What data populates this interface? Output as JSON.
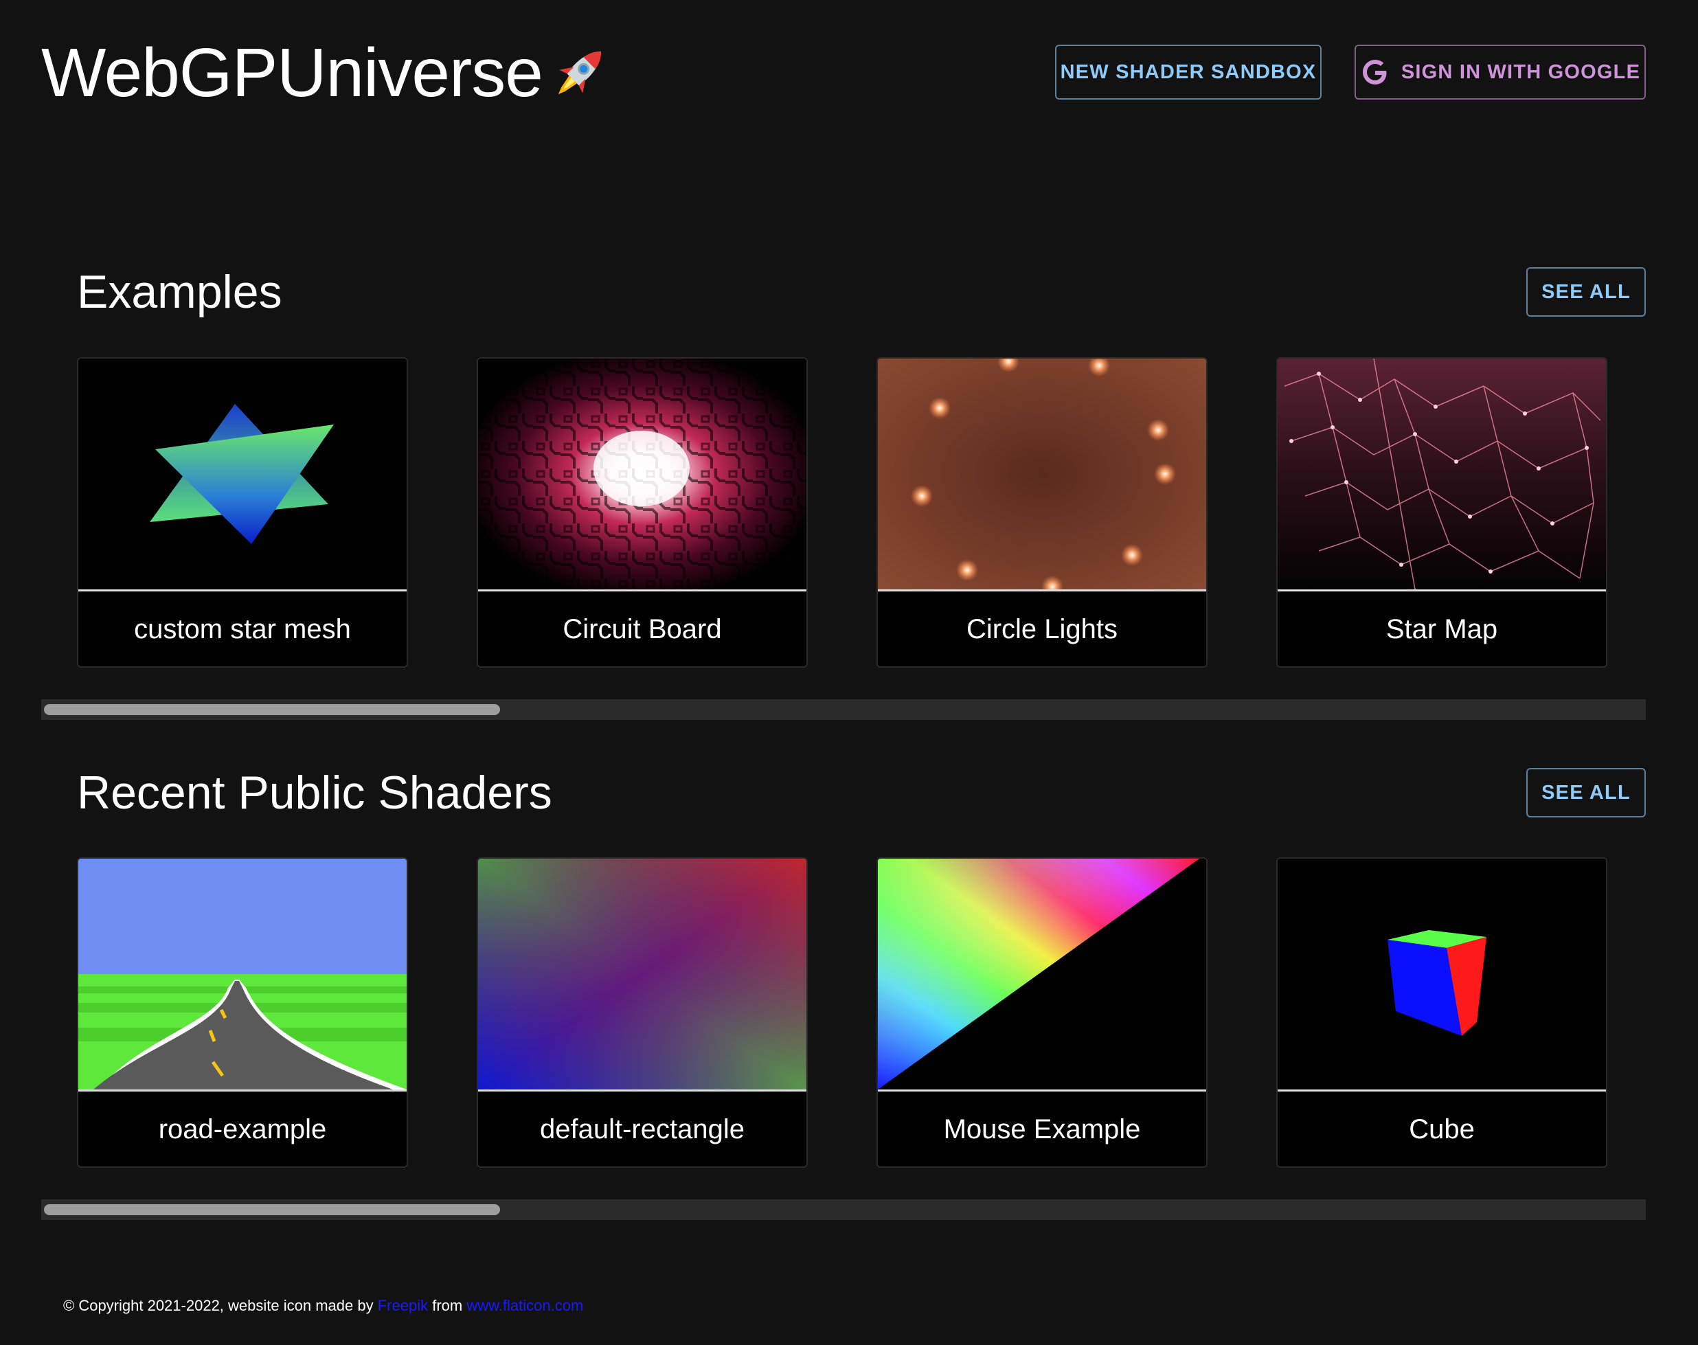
{
  "header": {
    "title": "WebGPUniverse",
    "logo_icon": "rocket-icon",
    "new_sandbox_label": "NEW SHADER SANDBOX",
    "sign_in_label": "SIGN IN WITH GOOGLE",
    "sign_in_icon": "google-icon"
  },
  "examples": {
    "title": "Examples",
    "see_all_label": "SEE ALL",
    "cards": [
      {
        "label": "custom star mesh"
      },
      {
        "label": "Circuit Board"
      },
      {
        "label": "Circle Lights"
      },
      {
        "label": "Star Map"
      }
    ]
  },
  "recent": {
    "title": "Recent Public Shaders",
    "see_all_label": "SEE ALL",
    "cards": [
      {
        "label": "road-example"
      },
      {
        "label": "default-rectangle"
      },
      {
        "label": "Mouse Example"
      },
      {
        "label": "Cube"
      }
    ]
  },
  "footer": {
    "copyright": "© Copyright 2021-2022, website icon made by",
    "author_link": "Freepik",
    "from_text": "from",
    "site_link": "www.flaticon.com"
  },
  "colors": {
    "background": "#121212",
    "primary": "#90caf9",
    "secondary": "#ce93d8",
    "link": "#1a1aff"
  }
}
